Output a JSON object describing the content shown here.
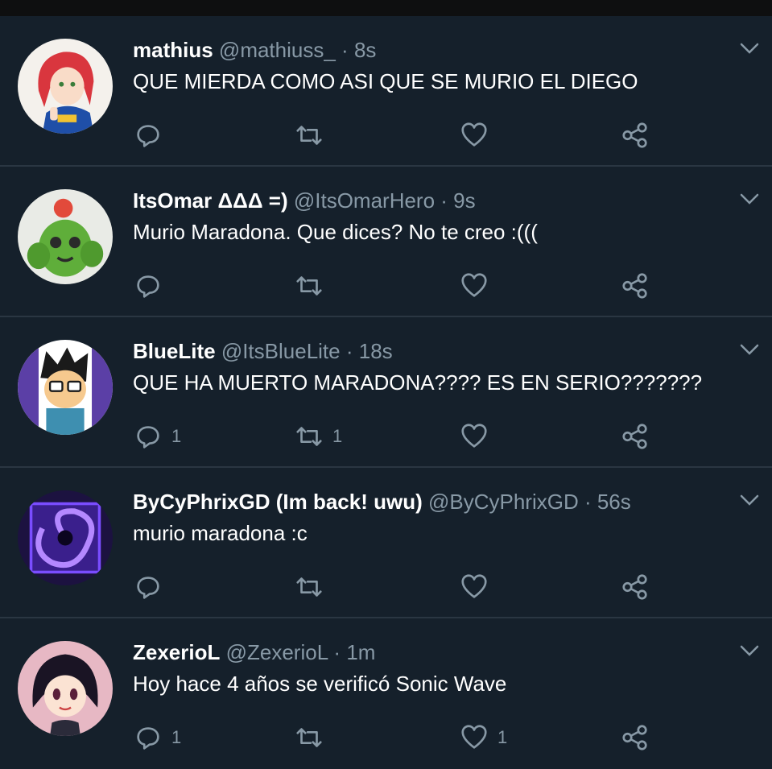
{
  "colors": {
    "background": "#15202b",
    "text": "#ffffff",
    "secondary": "#8899a6",
    "divider": "#2a3642"
  },
  "tweets": [
    {
      "name": "mathius",
      "handle": "@mathiuss_",
      "separator": " · ",
      "time": "8s",
      "text": "QUE MIERDA COMO ASI QUE SE MURIO EL DIEGO",
      "reply_count": "",
      "retweet_count": "",
      "like_count": "",
      "avatar": "anime-girl-red-hair"
    },
    {
      "name": "ItsOmar ΔΔΔ =)",
      "handle": "@ItsOmarHero",
      "separator": " · ",
      "time": "9s",
      "text": "Murio Maradona. Que dices? No te creo :(((",
      "reply_count": "",
      "retweet_count": "",
      "like_count": "",
      "avatar": "green-cactus-character"
    },
    {
      "name": "BlueLite",
      "handle": "@ItsBlueLite",
      "separator": " · ",
      "time": "18s",
      "text": "QUE HA MUERTO MARADONA???? ES EN SERIO???????",
      "reply_count": "1",
      "retweet_count": "1",
      "like_count": "",
      "avatar": "cartoon-boy-glasses"
    },
    {
      "name": "ByCyPhrixGD (Im back! uwu)",
      "handle": "@ByCyPhrixGD",
      "separator": " · ",
      "time": "56s",
      "text": "murio maradona :c",
      "reply_count": "",
      "retweet_count": "",
      "like_count": "",
      "avatar": "purple-vortex"
    },
    {
      "name": "ZexerioL",
      "handle": "@ZexerioL",
      "separator": " · ",
      "time": "1m",
      "text": "Hoy hace 4 años se verificó Sonic Wave",
      "reply_count": "1",
      "retweet_count": "",
      "like_count": "1",
      "avatar": "anime-girl-dark-hair"
    }
  ]
}
